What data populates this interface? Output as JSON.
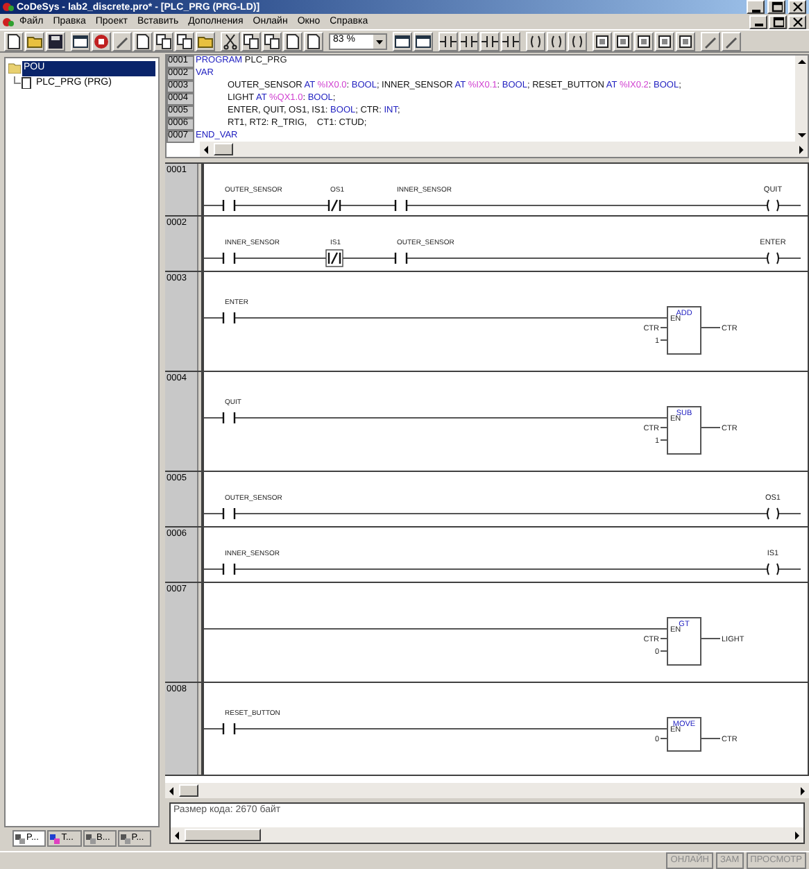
{
  "window": {
    "title": "CoDeSys - lab2_discrete.pro* - [PLC_PRG (PRG-LD)]"
  },
  "menu": [
    "Файл",
    "Правка",
    "Проект",
    "Вставить",
    "Дополнения",
    "Онлайн",
    "Окно",
    "Справка"
  ],
  "toolbar": {
    "zoom": "83 %"
  },
  "tree": [
    {
      "label": "POU",
      "selected": true,
      "children": [
        {
          "label": "PLC_PRG (PRG)",
          "selected": false
        }
      ]
    }
  ],
  "left_tabs": [
    {
      "label": "P...",
      "selected": true
    },
    {
      "label": "T...",
      "selected": false
    },
    {
      "label": "B...",
      "selected": false
    },
    {
      "label": "P...",
      "selected": false
    }
  ],
  "declarations": [
    {
      "number": "0001",
      "indented": false,
      "segments": [
        {
          "kind": "keyword",
          "text": "PROGRAM"
        },
        {
          "kind": "plain",
          "text": " PLC_PRG"
        }
      ]
    },
    {
      "number": "0002",
      "indented": false,
      "segments": [
        {
          "kind": "keyword",
          "text": "VAR"
        }
      ]
    },
    {
      "number": "0003",
      "indented": true,
      "segments": [
        {
          "kind": "plain",
          "text": "OUTER_SENSOR "
        },
        {
          "kind": "keyword",
          "text": "AT"
        },
        {
          "kind": "address",
          "text": " %IX0.0"
        },
        {
          "kind": "plain",
          "text": ": "
        },
        {
          "kind": "keyword",
          "text": "BOOL"
        },
        {
          "kind": "plain",
          "text": "; INNER_SENSOR "
        },
        {
          "kind": "keyword",
          "text": "AT"
        },
        {
          "kind": "address",
          "text": " %IX0.1"
        },
        {
          "kind": "plain",
          "text": ": "
        },
        {
          "kind": "keyword",
          "text": "BOOL"
        },
        {
          "kind": "plain",
          "text": "; RESET_BUTTON "
        },
        {
          "kind": "keyword",
          "text": "AT"
        },
        {
          "kind": "address",
          "text": " %IX0.2"
        },
        {
          "kind": "plain",
          "text": ": "
        },
        {
          "kind": "keyword",
          "text": "BOOL"
        },
        {
          "kind": "plain",
          "text": ";"
        }
      ]
    },
    {
      "number": "0004",
      "indented": true,
      "segments": [
        {
          "kind": "plain",
          "text": "LIGHT "
        },
        {
          "kind": "keyword",
          "text": "AT"
        },
        {
          "kind": "address",
          "text": " %QX1.0"
        },
        {
          "kind": "plain",
          "text": ": "
        },
        {
          "kind": "keyword",
          "text": "BOOL"
        },
        {
          "kind": "plain",
          "text": ";"
        }
      ]
    },
    {
      "number": "0005",
      "indented": true,
      "segments": [
        {
          "kind": "plain",
          "text": "ENTER, QUIT, OS1, IS1: "
        },
        {
          "kind": "keyword",
          "text": "BOOL"
        },
        {
          "kind": "plain",
          "text": "; CTR: "
        },
        {
          "kind": "keyword",
          "text": "INT"
        },
        {
          "kind": "plain",
          "text": ";"
        }
      ]
    },
    {
      "number": "0006",
      "indented": true,
      "segments": [
        {
          "kind": "plain",
          "text": "RT1, RT2: R_TRIG,    CT1: CTUD;"
        }
      ]
    },
    {
      "number": "0007",
      "indented": false,
      "segments": [
        {
          "kind": "keyword",
          "text": "END_VAR"
        }
      ]
    }
  ],
  "networks": [
    {
      "number": "0001",
      "contacts": [
        {
          "label": "OUTER_SENSOR",
          "negated": false,
          "selected": false
        },
        {
          "label": "OS1",
          "negated": true,
          "selected": false
        },
        {
          "label": "INNER_SENSOR",
          "negated": false,
          "selected": false
        }
      ],
      "output": {
        "kind": "coil",
        "label": "QUIT"
      }
    },
    {
      "number": "0002",
      "contacts": [
        {
          "label": "INNER_SENSOR",
          "negated": false,
          "selected": false
        },
        {
          "label": "IS1",
          "negated": true,
          "selected": true
        },
        {
          "label": "OUTER_SENSOR",
          "negated": false,
          "selected": false
        }
      ],
      "output": {
        "kind": "coil",
        "label": "ENTER"
      }
    },
    {
      "number": "0003",
      "contacts": [
        {
          "label": "ENTER",
          "negated": false,
          "selected": false
        }
      ],
      "output": {
        "kind": "box",
        "name": "ADD",
        "enable": "EN",
        "inputs": [
          "CTR",
          "1"
        ],
        "result": "CTR"
      }
    },
    {
      "number": "0004",
      "contacts": [
        {
          "label": "QUIT",
          "negated": false,
          "selected": false
        }
      ],
      "output": {
        "kind": "box",
        "name": "SUB",
        "enable": "EN",
        "inputs": [
          "CTR",
          "1"
        ],
        "result": "CTR"
      }
    },
    {
      "number": "0005",
      "contacts": [
        {
          "label": "OUTER_SENSOR",
          "negated": false,
          "selected": false
        }
      ],
      "output": {
        "kind": "coil",
        "label": "OS1"
      }
    },
    {
      "number": "0006",
      "contacts": [
        {
          "label": "INNER_SENSOR",
          "negated": false,
          "selected": false
        }
      ],
      "output": {
        "kind": "coil",
        "label": "IS1"
      }
    },
    {
      "number": "0007",
      "output": {
        "kind": "box",
        "name": "GT",
        "enable": "EN",
        "inputs": [
          "CTR",
          "0"
        ],
        "result": "LIGHT"
      }
    },
    {
      "number": "0008",
      "contacts": [
        {
          "label": "RESET_BUTTON",
          "negated": false,
          "selected": false
        }
      ],
      "output": {
        "kind": "box",
        "name": "MOVE",
        "enable": "EN",
        "inputs": [
          "0"
        ],
        "result": "CTR"
      }
    }
  ],
  "messages": [
    "Размер кода: 2670 байт"
  ],
  "status_bar": [
    {
      "label": "ОНЛАЙН",
      "disabled": true
    },
    {
      "label": "ЗАМ",
      "disabled": true
    },
    {
      "label": "ПРОСМОТР",
      "disabled": true
    }
  ]
}
